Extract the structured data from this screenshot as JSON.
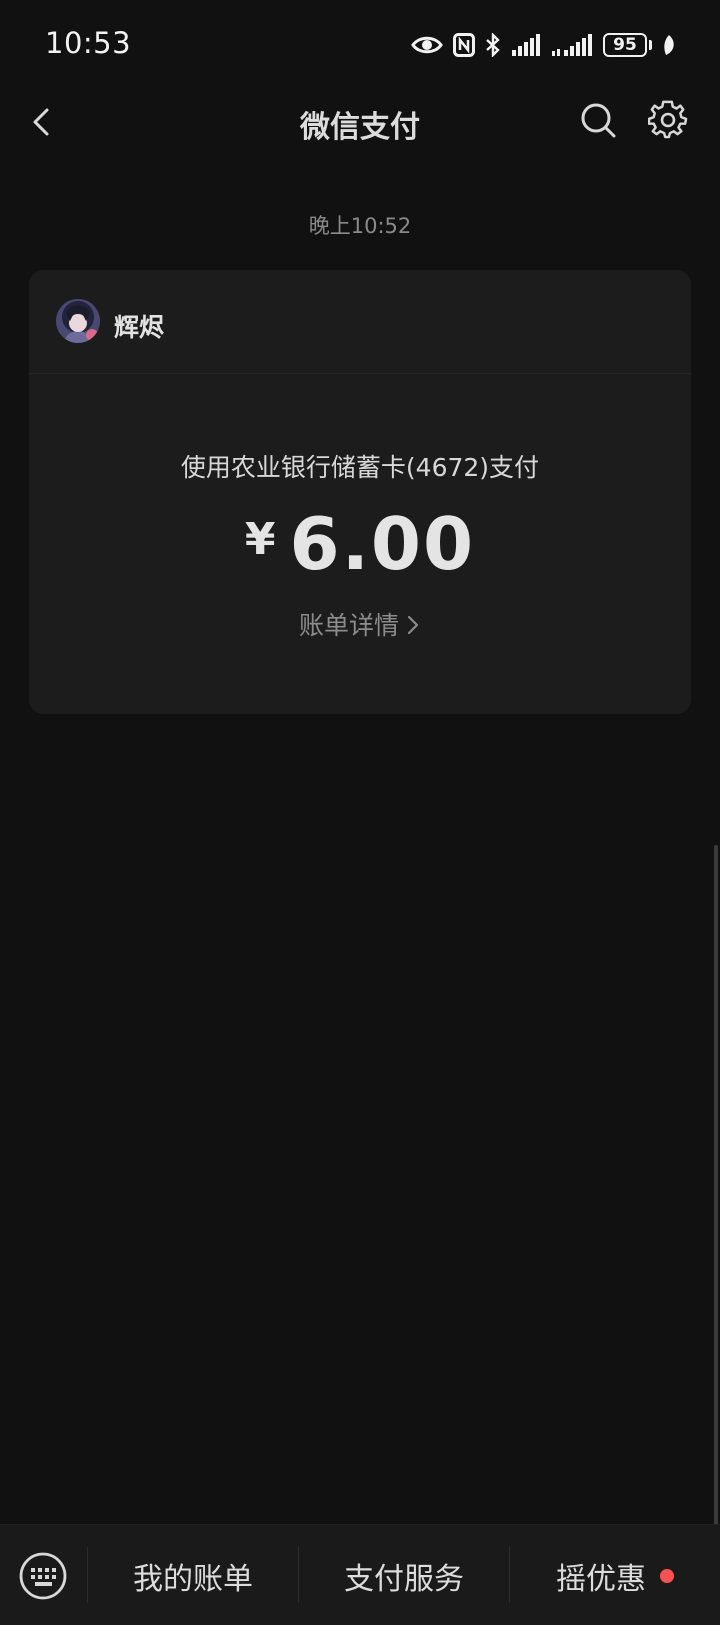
{
  "status_bar": {
    "time": "10:53",
    "battery": "95",
    "icons": [
      "eye-icon",
      "nfc-icon",
      "bluetooth-icon",
      "signal-icon",
      "signal-icon",
      "battery-icon",
      "leaf-icon"
    ]
  },
  "nav": {
    "title": "微信支付",
    "back_icon": "chevron-left-icon",
    "search_icon": "search-icon",
    "settings_icon": "gear-icon"
  },
  "message": {
    "time": "晚上10:52",
    "merchant": "辉烬",
    "description": "使用农业银行储蓄卡(4672)支付",
    "currency": "¥",
    "amount": "6.00",
    "detail_link": "账单详情"
  },
  "bottom_bar": {
    "keyboard_icon": "keyboard-icon",
    "tabs": [
      {
        "label": "我的账单"
      },
      {
        "label": "支付服务"
      },
      {
        "label": "摇优惠",
        "badge": "red-dot"
      }
    ]
  },
  "colors": {
    "background": "#111111",
    "card": "#1c1c1c",
    "badge": "#fa5151"
  }
}
